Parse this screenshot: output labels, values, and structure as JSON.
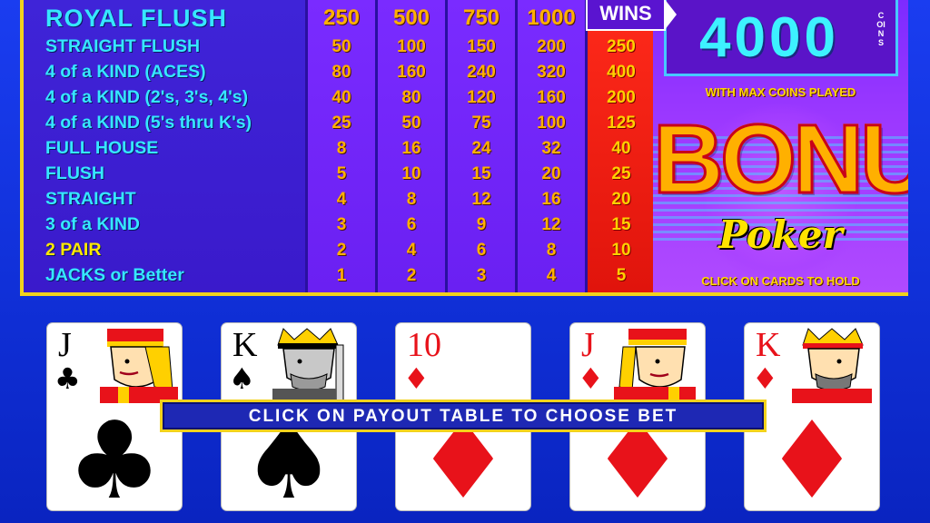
{
  "paytable": {
    "coin_headers": [
      "250",
      "500",
      "750",
      "1000"
    ],
    "wins_header": "WINS",
    "active_column": 4,
    "hands": [
      {
        "name": "ROYAL FLUSH",
        "values": [
          "",
          "",
          "",
          ""
        ],
        "win": ""
      },
      {
        "name": "STRAIGHT FLUSH",
        "values": [
          "50",
          "100",
          "150",
          "200"
        ],
        "win": "250"
      },
      {
        "name": "4 of a KIND (ACES)",
        "values": [
          "80",
          "160",
          "240",
          "320"
        ],
        "win": "400"
      },
      {
        "name": "4 of a KIND (2's, 3's, 4's)",
        "values": [
          "40",
          "80",
          "120",
          "160"
        ],
        "win": "200"
      },
      {
        "name": "4 of a KIND (5's thru K's)",
        "values": [
          "25",
          "50",
          "75",
          "100"
        ],
        "win": "125"
      },
      {
        "name": "FULL HOUSE",
        "values": [
          "8",
          "16",
          "24",
          "32"
        ],
        "win": "40"
      },
      {
        "name": "FLUSH",
        "values": [
          "5",
          "10",
          "15",
          "20"
        ],
        "win": "25"
      },
      {
        "name": "STRAIGHT",
        "values": [
          "4",
          "8",
          "12",
          "16"
        ],
        "win": "20"
      },
      {
        "name": "3 of a KIND",
        "values": [
          "3",
          "6",
          "9",
          "12"
        ],
        "win": "15"
      },
      {
        "name": "2 PAIR",
        "values": [
          "2",
          "4",
          "6",
          "8"
        ],
        "win": "10"
      },
      {
        "name": "JACKS or Better",
        "values": [
          "1",
          "2",
          "3",
          "4"
        ],
        "win": "5"
      }
    ]
  },
  "promo": {
    "royal_amount": "4000",
    "coins_label": "COINS",
    "max_coins_text": "WITH MAX COINS PLAYED",
    "logo_top": "BONUS",
    "logo_bottom": "Poker",
    "hold_hint": "CLICK ON CARDS TO HOLD"
  },
  "cards": [
    {
      "rank": "J",
      "suit": "♣",
      "color": "black",
      "face": "jack-of-clubs"
    },
    {
      "rank": "K",
      "suit": "♠",
      "color": "black",
      "face": "king-of-spades"
    },
    {
      "rank": "10",
      "suit": "♦",
      "color": "red",
      "face": ""
    },
    {
      "rank": "J",
      "suit": "♦",
      "color": "red",
      "face": "jack-of-diamonds"
    },
    {
      "rank": "K",
      "suit": "♦",
      "color": "red",
      "face": "king-of-diamonds"
    }
  ],
  "banner": {
    "text": "CLICK ON PAYOUT TABLE TO CHOOSE BET"
  },
  "colors": {
    "background": "#1a3df0",
    "table_border": "#f2d21c",
    "hand_name": "#36e7ff",
    "payout_value": "#ffb000",
    "active_column": "#ff2a1a",
    "coin_column": "#7a2bff"
  }
}
